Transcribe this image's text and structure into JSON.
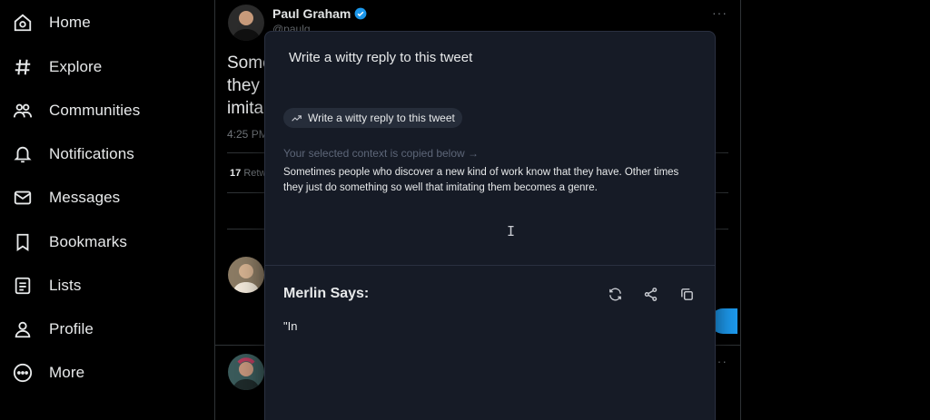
{
  "nav": {
    "items": [
      {
        "label": "Home",
        "icon": "home-icon"
      },
      {
        "label": "Explore",
        "icon": "hashtag-icon"
      },
      {
        "label": "Communities",
        "icon": "people-icon"
      },
      {
        "label": "Notifications",
        "icon": "bell-icon"
      },
      {
        "label": "Messages",
        "icon": "envelope-icon"
      },
      {
        "label": "Bookmarks",
        "icon": "bookmark-icon"
      },
      {
        "label": "Lists",
        "icon": "list-icon"
      },
      {
        "label": "Profile",
        "icon": "person-icon"
      },
      {
        "label": "More",
        "icon": "more-circle-icon"
      }
    ]
  },
  "tweet": {
    "author_name": "Paul Graham",
    "handle": "@paulg",
    "text_lines": [
      "Some",
      "they",
      "imita"
    ],
    "time": "4:25 PM",
    "retweet_count": "17",
    "retweet_label": "Retw",
    "more": "···"
  },
  "merlin": {
    "prompt": "Write a witty reply to this tweet",
    "chip_label": "Write a witty reply to this tweet",
    "context_label": "Your selected context is copied below →",
    "context_text": "Sometimes people who discover a new kind of work know that they have. Other times they just do something so well that imitating them becomes a genre.",
    "says_label": "Merlin Says:",
    "answer": "\"In"
  },
  "colors": {
    "background": "#000000",
    "panel": "#161b26",
    "verified": "#1d9bf0",
    "muted": "#71767b"
  }
}
